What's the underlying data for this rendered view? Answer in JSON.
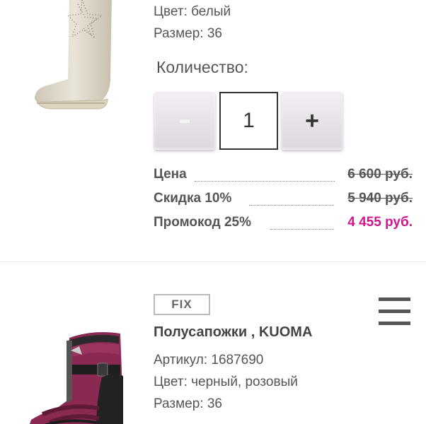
{
  "item1": {
    "color": "Цвет: белый",
    "size": "Размер: 36",
    "quantity_label": "Количество:",
    "quantity_value": "1",
    "minus_label": "-",
    "plus_label": "+",
    "prices": [
      {
        "label": "Цена",
        "value": "6 600 руб.",
        "style": "strike"
      },
      {
        "label": "Скидка 10%",
        "value": "5 940 руб.",
        "style": "strike"
      },
      {
        "label": "Промокод 25%",
        "value": "4 455 руб.",
        "style": "promo"
      }
    ]
  },
  "item2": {
    "badge": "FIX",
    "title": "Полусапожки , KUOMA",
    "article": "Артикул: 1687690",
    "color": "Цвет: черный, розовый",
    "size": "Размер: 36"
  },
  "colors": {
    "promo": "#d4148f",
    "text": "#555555"
  }
}
